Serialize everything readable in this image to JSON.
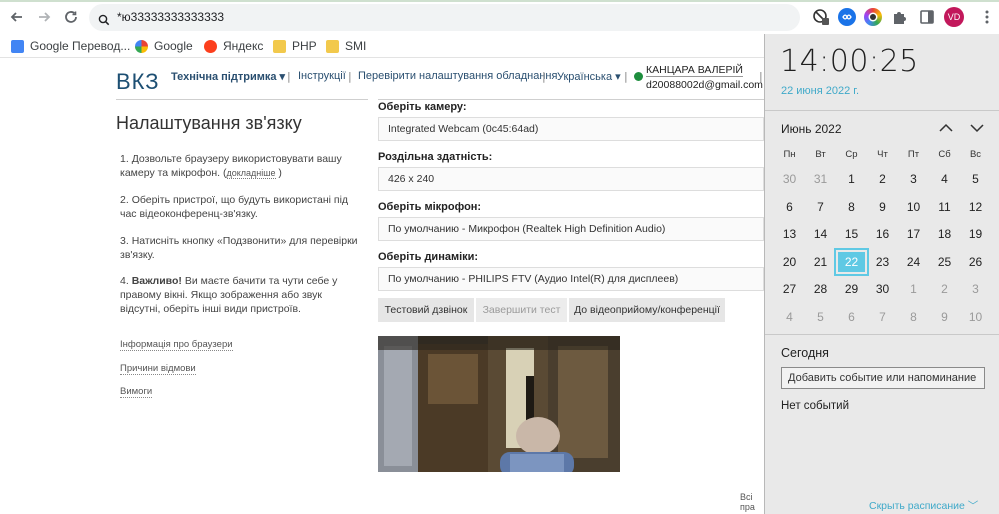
{
  "browser": {
    "address": "*ю33333333333333",
    "profile_initials": "VD",
    "bookmarks": [
      "Google Перевод...",
      "Google",
      "Яндекс",
      "PHP",
      "SMI"
    ]
  },
  "site": {
    "logo": "ВКЗ",
    "nav": {
      "support": "Технічна підтримка",
      "instructions": "Інструкції",
      "check": "Перевірити налаштування обладнання",
      "language": "Українська",
      "user_name": "КАНЦАРА ВАЛЕРІЙ",
      "user_email": "d20088002d@gmail.com"
    },
    "title": "Налаштування зв'язку",
    "steps": [
      {
        "n": "1.",
        "text": "Дозвольте браузеру використовувати вашу камеру та мікрофон. (",
        "link": "докладніше",
        "after": " )"
      },
      {
        "n": "2.",
        "text": "Оберіть пристрої, що будуть використані під час відеоконференц-зв'язку."
      },
      {
        "n": "3.",
        "text": "Натисніть кнопку «Подзвонити» для перевірки зв'язку."
      },
      {
        "n": "4.",
        "bold": "Важливо!",
        "text": " Ви маєте бачити та чути себе у правому вікні. Якщо зображення або звук відсутні, оберіть інші види пристроїв."
      }
    ],
    "left_links": [
      "Інформація про браузери",
      "Причини відмови",
      "Вимоги"
    ],
    "fields": [
      {
        "label": "Оберіть камеру:",
        "value": "Integrated Webcam (0c45:64ad)"
      },
      {
        "label": "Роздільна здатність:",
        "value": "426 x 240"
      },
      {
        "label": "Оберіть мікрофон:",
        "value": "По умолчанию - Микрофон (Realtek High Definition Audio)"
      },
      {
        "label": "Оберіть динаміки:",
        "value": "По умолчанию - PHILIPS FTV (Аудио Intel(R) для дисплеев)"
      }
    ],
    "buttons": {
      "test_call": "Тестовий дзвінок",
      "end_test": "Завершити тест",
      "to_conference": "До відеоприйому/конференції"
    },
    "footer_fragment": "Всі пра"
  },
  "calendar": {
    "time": "14:00:25",
    "date_full": "22 июня 2022 г.",
    "month": "Июнь 2022",
    "weekdays": [
      "Пн",
      "Вт",
      "Ср",
      "Чт",
      "Пт",
      "Сб",
      "Вс"
    ],
    "weeks": [
      [
        "30",
        "31",
        "1",
        "2",
        "3",
        "4",
        "5"
      ],
      [
        "6",
        "7",
        "8",
        "9",
        "10",
        "11",
        "12"
      ],
      [
        "13",
        "14",
        "15",
        "16",
        "17",
        "18",
        "19"
      ],
      [
        "20",
        "21",
        "22",
        "23",
        "24",
        "25",
        "26"
      ],
      [
        "27",
        "28",
        "29",
        "30",
        "1",
        "2",
        "3"
      ],
      [
        "4",
        "5",
        "6",
        "7",
        "8",
        "9",
        "10"
      ]
    ],
    "selected_day": "22",
    "today_label": "Сегодня",
    "add_event_label": "Добавить событие или напоминание",
    "no_events": "Нет событий",
    "hide_schedule": "Скрыть расписание",
    "accent_color": "#5fc9e4"
  }
}
